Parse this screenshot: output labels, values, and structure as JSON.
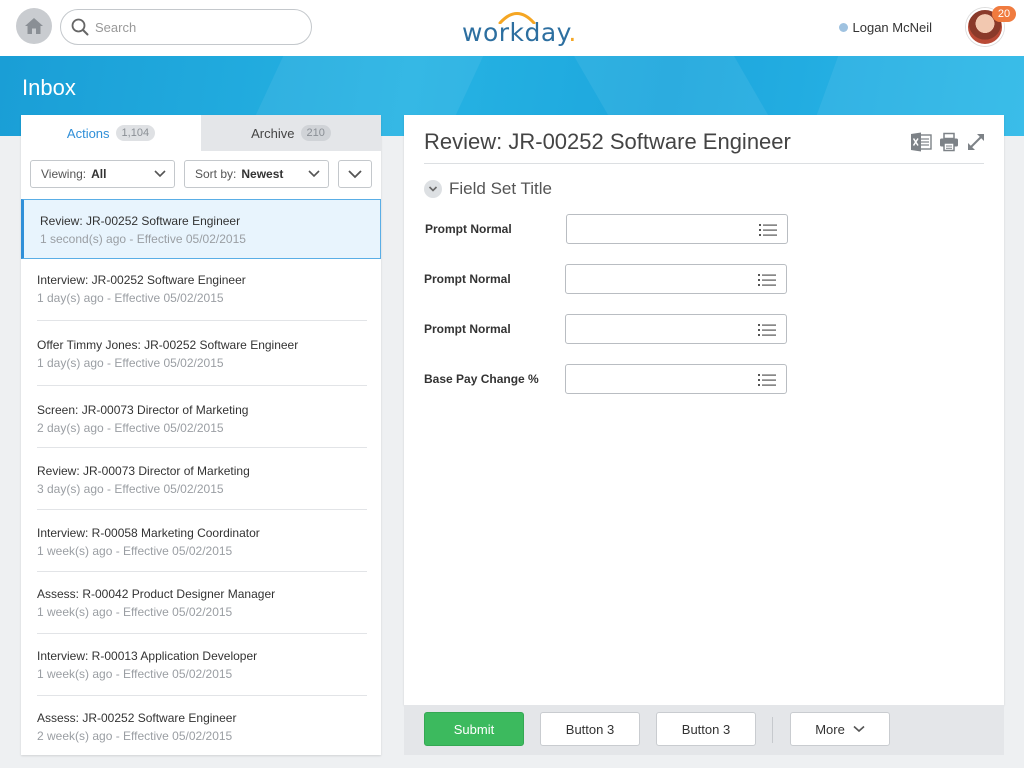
{
  "header": {
    "search_placeholder": "Search",
    "logo_text": "workday",
    "logo_dot": ".",
    "user_name": "Logan McNeil",
    "notification_count": "20"
  },
  "banner": {
    "title": "Inbox"
  },
  "left_panel": {
    "tabs": [
      {
        "label": "Actions",
        "count": "1,104"
      },
      {
        "label": "Archive",
        "count": "210"
      }
    ],
    "viewing": {
      "label": "Viewing:",
      "value": "All"
    },
    "sort": {
      "label": "Sort by:",
      "value": "Newest"
    },
    "items": [
      {
        "title": "Review: JR-00252 Software Engineer",
        "meta": "1 second(s) ago - Effective 05/02/2015"
      },
      {
        "title": "Interview: JR-00252 Software Engineer",
        "meta": "1 day(s) ago - Effective 05/02/2015"
      },
      {
        "title": "Offer Timmy Jones: JR-00252 Software Engineer",
        "meta": "1 day(s) ago - Effective 05/02/2015"
      },
      {
        "title": "Screen: JR-00073 Director of Marketing",
        "meta": "2 day(s) ago - Effective 05/02/2015"
      },
      {
        "title": "Review: JR-00073 Director of Marketing",
        "meta": "3 day(s) ago - Effective 05/02/2015"
      },
      {
        "title": "Interview: R-00058 Marketing Coordinator",
        "meta": "1 week(s) ago - Effective 05/02/2015"
      },
      {
        "title": "Assess: R-00042 Product Designer Manager",
        "meta": "1 week(s) ago - Effective 05/02/2015"
      },
      {
        "title": "Interview: R-00013 Application Developer",
        "meta": "1 week(s) ago - Effective 05/02/2015"
      },
      {
        "title": "Assess: JR-00252 Software Engineer",
        "meta": "2 week(s) ago - Effective 05/02/2015"
      }
    ]
  },
  "detail": {
    "title": "Review: JR-00252 Software Engineer",
    "fieldset_title": "Field Set Title",
    "fields": [
      {
        "label": "Prompt Normal"
      },
      {
        "label": "Prompt Normal"
      },
      {
        "label": "Prompt Normal"
      },
      {
        "label": "Base Pay Change %"
      }
    ]
  },
  "footer": {
    "submit_label": "Submit",
    "button_a_label": "Button 3",
    "button_b_label": "Button 3",
    "more_label": "More"
  },
  "colors": {
    "accent_blue": "#2f8fd8",
    "banner_blue": "#1da6dd",
    "submit_green": "#3cba5e",
    "badge_orange": "#f07b3f"
  },
  "icons": [
    "home-icon",
    "search-icon",
    "excel-export-icon",
    "print-icon",
    "expand-icon",
    "chevron-down-icon",
    "prompt-list-icon"
  ]
}
